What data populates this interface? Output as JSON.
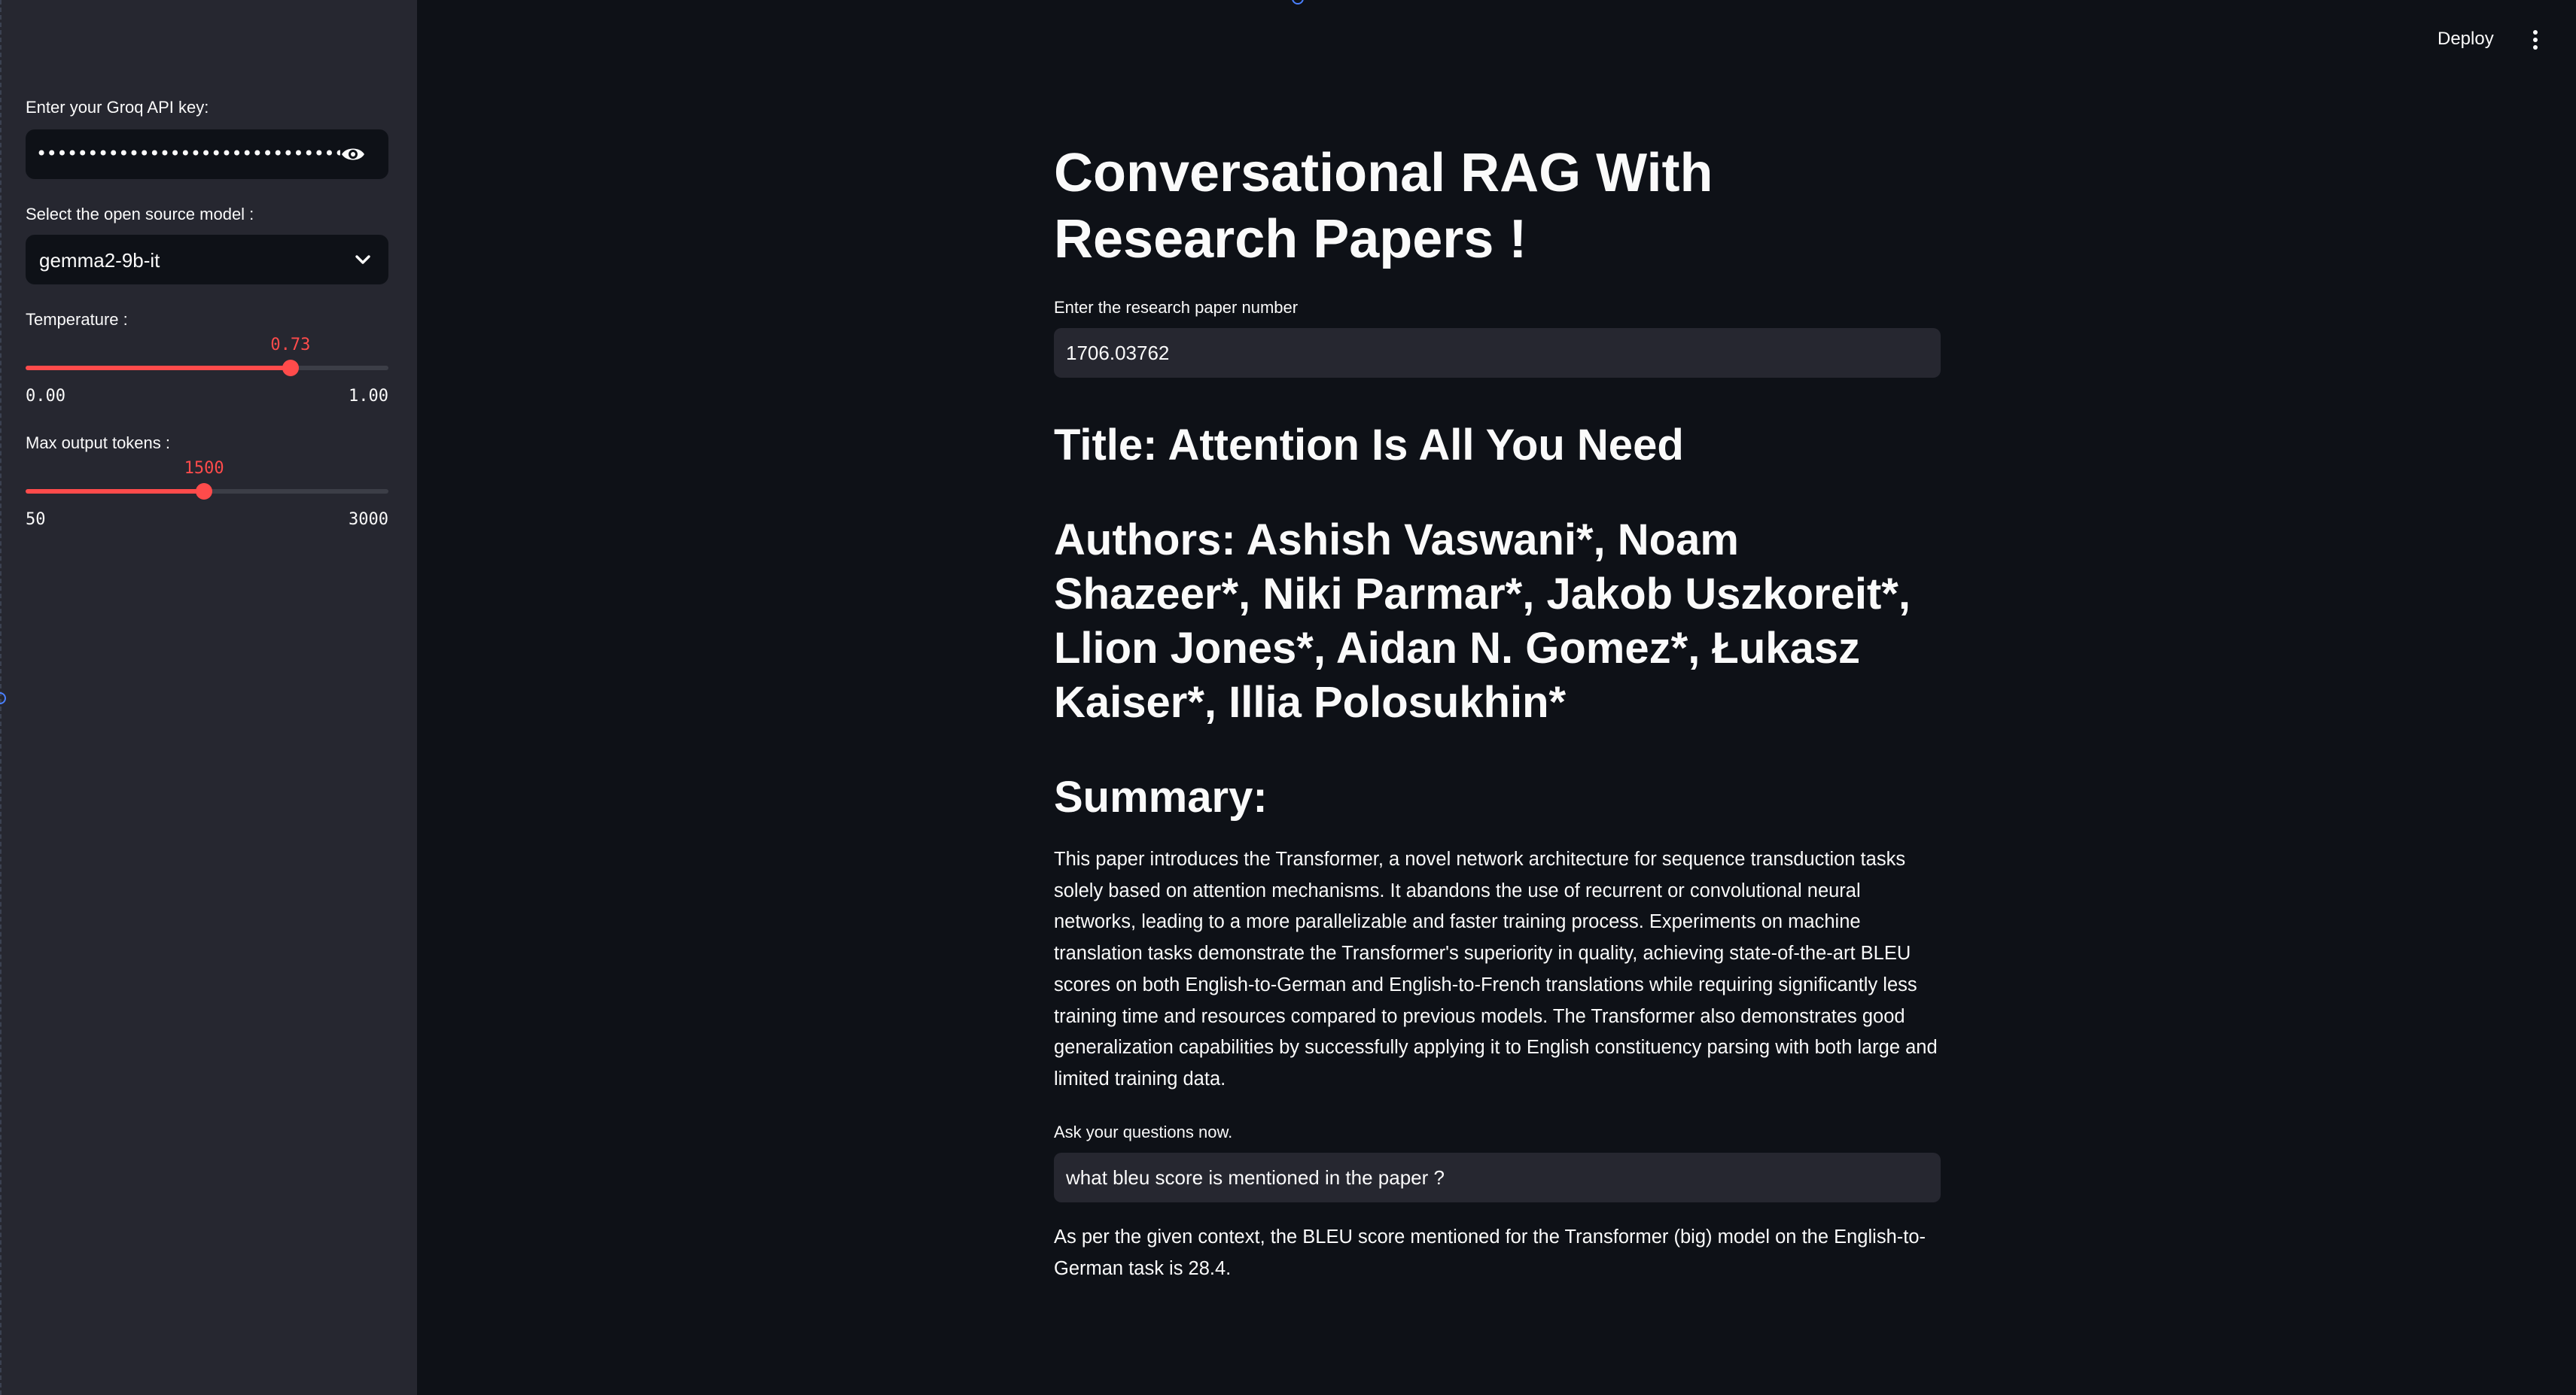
{
  "sidebar": {
    "api_key_label": "Enter your Groq API key:",
    "api_key_masked": "•••••••••••••••••••••••••••••••••••••••••••••••••",
    "model_label": "Select the open source model :",
    "model_value": "gemma2-9b-it",
    "temperature": {
      "label": "Temperature :",
      "value": "0.73",
      "min": "0.00",
      "max": "1.00",
      "fraction": 0.73
    },
    "max_tokens": {
      "label": "Max output tokens :",
      "value": "1500",
      "min": "50",
      "max": "3000",
      "fraction": 0.492
    }
  },
  "header": {
    "deploy_label": "Deploy"
  },
  "main": {
    "title": "Conversational RAG With Research Papers !",
    "paper_number_label": "Enter the research paper number",
    "paper_number_value": "1706.03762",
    "paper_title": "Title: Attention Is All You Need",
    "authors": "Authors: Ashish Vaswani*, Noam Shazeer*, Niki Parmar*, Jakob Uszkoreit*, Llion Jones*, Aidan N. Gomez*, Łukasz Kaiser*, Illia Polosukhin*",
    "summary_heading": "Summary:",
    "summary_text": "This paper introduces the Transformer, a novel network architecture for sequence transduction tasks solely based on attention mechanisms. It abandons the use of recurrent or convolutional neural networks, leading to a more parallelizable and faster training process. Experiments on machine translation tasks demonstrate the Transformer's superiority in quality, achieving state-of-the-art BLEU scores on both English-to-German and English-to-French translations while requiring significantly less training time and resources compared to previous models. The Transformer also demonstrates good generalization capabilities by successfully applying it to English constituency parsing with both large and limited training data.",
    "question_label": "Ask your questions now.",
    "question_value": "what bleu score is mentioned in the paper ?",
    "answer_text": "As per the given context, the BLEU score mentioned for the Transformer (big) model on the English-to-German task is 28.4."
  },
  "colors": {
    "accent": "#ff4b4b",
    "sidebar_bg": "#262730",
    "main_bg": "#0e1117"
  },
  "icons": [
    "eye-icon",
    "chevron-down-icon",
    "kebab-menu-icon"
  ]
}
